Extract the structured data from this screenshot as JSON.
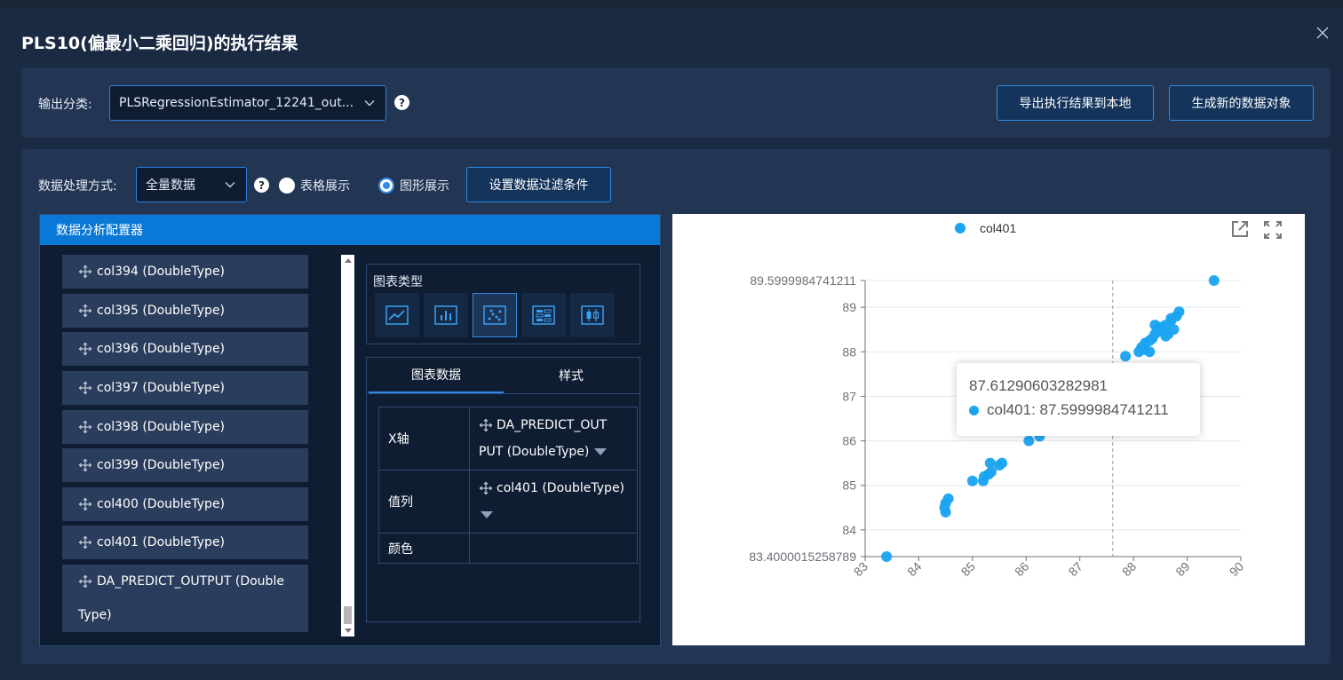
{
  "dialog": {
    "title": "PLS10(偏最小二乘回归)的执行结果"
  },
  "output": {
    "label": "输出分类:",
    "selected": "PLSRegressionEstimator_12241_out...",
    "export_button": "导出执行结果到本地",
    "generate_button": "生成新的数据对象"
  },
  "processing": {
    "label": "数据处理方式:",
    "mode_selected": "全量数据",
    "radio_table": "表格展示",
    "radio_chart": "图形展示",
    "selected_view": "图形展示",
    "filter_button": "设置数据过滤条件"
  },
  "analyzer": {
    "header": "数据分析配置器",
    "fields": [
      "col394 (DoubleType)",
      "col395 (DoubleType)",
      "col396 (DoubleType)",
      "col397 (DoubleType)",
      "col398 (DoubleType)",
      "col399 (DoubleType)",
      "col400 (DoubleType)",
      "col401 (DoubleType)",
      "DA_PREDICT_OUTPUT (DoubleType)"
    ],
    "last_field_line1": "DA_PREDICT_OUTPUT (Double",
    "last_field_line2": "Type)",
    "chart_type_title": "图表类型",
    "chart_types": [
      "line-chart-icon",
      "bar-chart-icon",
      "scatter-chart-icon",
      "heatmap-chart-icon",
      "boxplot-chart-icon"
    ],
    "selected_chart_type": "scatter-chart-icon",
    "tabs": [
      "图表数据",
      "样式"
    ],
    "active_tab": "图表数据",
    "config": {
      "x_label": "X轴",
      "x_value_line1": "DA_PREDICT_OUT",
      "x_value_line2": "PUT (DoubleType)",
      "value_label": "值列",
      "value_value": "col401 (DoubleType)",
      "color_label": "颜色"
    }
  },
  "tooltip": {
    "x_value": "87.61290603282981",
    "series_label": "col401: 87.5999984741211"
  },
  "colors": {
    "accent": "#2f8ae6",
    "point": "#1aa3f0",
    "header": "#0a78d6"
  },
  "chart_data": {
    "type": "scatter",
    "legend": [
      "col401"
    ],
    "legend_position": "top-center",
    "xlim": [
      83,
      90
    ],
    "ylim": [
      83.4000015258789,
      89.5999984741211
    ],
    "x_ticks": [
      "83",
      "84",
      "85",
      "86",
      "87",
      "88",
      "89",
      "90"
    ],
    "y_ticks": [
      "83.4000015258789",
      "84",
      "85",
      "86",
      "87",
      "88",
      "89",
      "89.5999984741211"
    ],
    "grid": true,
    "crosshair_x": 87.61290603282981,
    "series": [
      {
        "name": "col401",
        "points": [
          [
            83.4,
            83.4
          ],
          [
            84.5,
            84.4
          ],
          [
            84.48,
            84.5
          ],
          [
            84.5,
            84.6
          ],
          [
            84.55,
            84.7
          ],
          [
            85.0,
            85.1
          ],
          [
            85.2,
            85.1
          ],
          [
            85.22,
            85.2
          ],
          [
            85.3,
            85.25
          ],
          [
            85.35,
            85.3
          ],
          [
            85.33,
            85.5
          ],
          [
            85.5,
            85.45
          ],
          [
            85.55,
            85.5
          ],
          [
            86.05,
            86.0
          ],
          [
            86.25,
            86.1
          ],
          [
            87.6,
            87.6
          ],
          [
            87.85,
            87.9
          ],
          [
            88.1,
            88.0
          ],
          [
            88.15,
            88.1
          ],
          [
            88.2,
            88.05
          ],
          [
            88.22,
            88.2
          ],
          [
            88.3,
            88.0
          ],
          [
            88.3,
            88.25
          ],
          [
            88.35,
            88.3
          ],
          [
            88.4,
            88.4
          ],
          [
            88.45,
            88.5
          ],
          [
            88.4,
            88.6
          ],
          [
            88.5,
            88.55
          ],
          [
            88.55,
            88.45
          ],
          [
            88.6,
            88.6
          ],
          [
            88.65,
            88.4
          ],
          [
            88.7,
            88.7
          ],
          [
            88.75,
            88.5
          ],
          [
            88.8,
            88.8
          ],
          [
            88.85,
            88.9
          ],
          [
            88.7,
            88.75
          ],
          [
            88.6,
            88.35
          ],
          [
            89.5,
            89.6
          ]
        ]
      }
    ]
  }
}
